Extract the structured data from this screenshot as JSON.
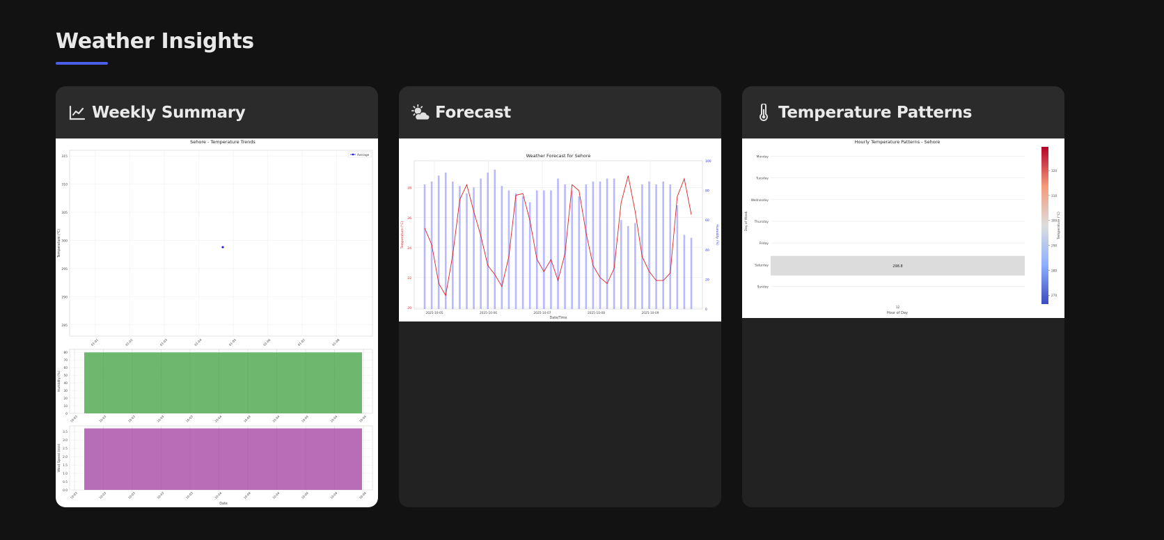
{
  "page": {
    "title": "Weather Insights",
    "accent": "#4b5ee8"
  },
  "cards": [
    {
      "title": "Weekly Summary",
      "icon": "line-chart-icon"
    },
    {
      "title": "Forecast",
      "icon": "sun-cloud-icon"
    },
    {
      "title": "Temperature Patterns",
      "icon": "thermometer-icon"
    }
  ],
  "chart_data": [
    {
      "type": "scatter",
      "title": "Sehore - Temperature Trends",
      "ylabel": "Temperature (°C)",
      "legend": "Average",
      "legend_position": "top-right",
      "yticks": [
        "285",
        "290",
        "295",
        "300",
        "305",
        "310",
        "315"
      ],
      "xticks": [
        "01-01",
        "01-02",
        "01-03",
        "01-04",
        "01-05",
        "01-06",
        "01-07",
        "01-08"
      ],
      "ylim": [
        283,
        316
      ],
      "points": [
        {
          "x": 4.5,
          "y": 298.8
        }
      ],
      "color": "#1f1fd6"
    },
    {
      "type": "bar",
      "ylabel": "Humidity (%)",
      "yticks": [
        "0",
        "10",
        "20",
        "30",
        "40",
        "50",
        "60",
        "70",
        "80"
      ],
      "xticks": [
        "10-03",
        "10-03",
        "10-03",
        "10-03",
        "10-03",
        "10-04",
        "10-04",
        "10-04",
        "10-04",
        "10-04",
        "10-04"
      ],
      "ylim": [
        0,
        84
      ],
      "values": [
        80
      ],
      "color": "#66b366"
    },
    {
      "type": "bar",
      "ylabel": "Wind Speed (m/s)",
      "xlabel": "Date",
      "yticks": [
        "0.0",
        "0.5",
        "1.0",
        "1.5",
        "2.0",
        "2.5",
        "3.0",
        "3.5"
      ],
      "xticks": [
        "10-03",
        "10-03",
        "10-03",
        "10-03",
        "10-03",
        "10-04",
        "10-04",
        "10-04",
        "10-04",
        "10-04",
        "10-04"
      ],
      "ylim": [
        0,
        3.85
      ],
      "values": [
        3.7
      ],
      "color": "#b366b3"
    },
    {
      "type": "line",
      "title": "Weather Forecast for Sehore",
      "xlabel": "Date/Time",
      "ylabel": "Temperature (°C)",
      "y2label": "Humidity (%)",
      "xticks": [
        "2025-10-05",
        "2025-10-06",
        "2025-10-07",
        "2025-10-08",
        "2025-10-09"
      ],
      "yticks": [
        "20",
        "22",
        "24",
        "26",
        "28"
      ],
      "y2ticks": [
        "0",
        "20",
        "40",
        "60",
        "80",
        "100"
      ],
      "temperature": [
        25.3,
        24.2,
        21.6,
        20.8,
        23.5,
        27.2,
        28.2,
        26.4,
        24.8,
        22.8,
        22.2,
        21.4,
        23.4,
        27.5,
        27.6,
        25.8,
        23.2,
        22.4,
        23.2,
        21.8,
        23.6,
        28.2,
        27.8,
        25.0,
        22.8,
        22.0,
        21.6,
        22.6,
        27.0,
        28.8,
        26.4,
        23.4,
        22.4,
        21.8,
        21.8,
        22.3,
        27.4,
        28.6,
        26.2
      ],
      "humidity": [
        84,
        86,
        90,
        92,
        86,
        83,
        78,
        82,
        88,
        92,
        94,
        83,
        80,
        78,
        76,
        72,
        80,
        80,
        80,
        88,
        84,
        80,
        76,
        84,
        86,
        86,
        88,
        88,
        60,
        56,
        58,
        84,
        86,
        84,
        86,
        84,
        70,
        50,
        48
      ],
      "temp_color": "#dd2222",
      "humidity_color": "#8080ff"
    },
    {
      "type": "heatmap",
      "title": "Hourly Temperature Patterns - Sehore",
      "xlabel": "Hour of Day",
      "ylabel": "Day of Week",
      "colorbar_label": "Temperature (°C)",
      "days": [
        "Monday",
        "Tuesday",
        "Wednesday",
        "Thursday",
        "Friday",
        "Saturday",
        "Sunday"
      ],
      "hours": [
        "12"
      ],
      "cells": [
        {
          "day": "Saturday",
          "hour": "12",
          "value": "298.8"
        }
      ],
      "colorbar_ticks": [
        "270",
        "280",
        "290",
        "300",
        "310",
        "320"
      ]
    }
  ]
}
